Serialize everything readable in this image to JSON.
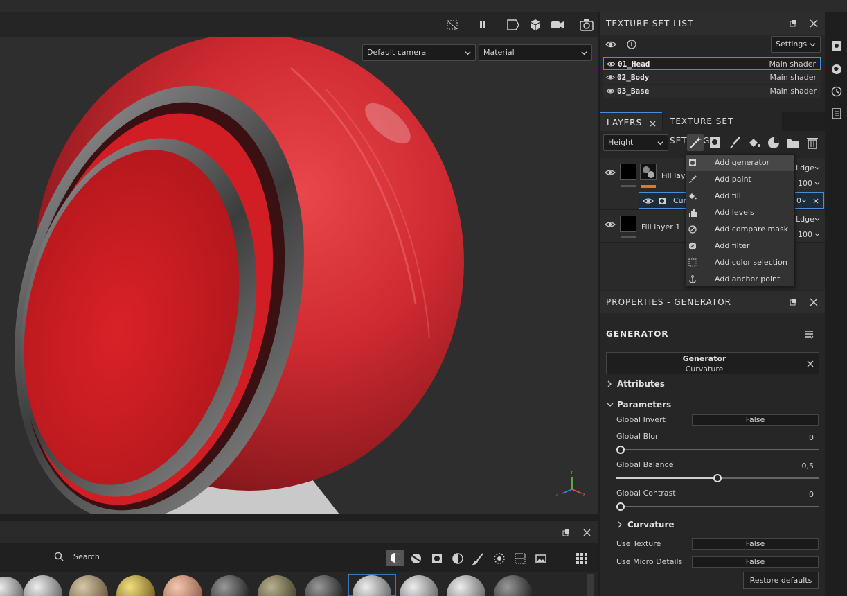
{
  "viewport": {
    "camera_select": "Default camera",
    "mode_select": "Material"
  },
  "texture_set_list": {
    "title": "TEXTURE SET LIST",
    "settings_label": "Settings",
    "items": [
      {
        "name": "01_Head",
        "shader": "Main shader"
      },
      {
        "name": "02_Body",
        "shader": "Main shader"
      },
      {
        "name": "03_Base",
        "shader": "Main shader"
      }
    ]
  },
  "layers_panel": {
    "tab_layers": "LAYERS",
    "tab_texture_settings": "TEXTURE SET SETTINGS",
    "channel_select": "Height",
    "layers": [
      {
        "name": "Fill lay",
        "blend": "Ldge",
        "opacity": "100"
      },
      {
        "name": "Cur",
        "opacity": "0"
      },
      {
        "name": "Fill layer 1",
        "blend": "Ldge",
        "opacity": "100"
      }
    ]
  },
  "add_menu": {
    "items": [
      {
        "label": "Add generator",
        "icon": "generator-icon"
      },
      {
        "label": "Add paint",
        "icon": "brush-icon"
      },
      {
        "label": "Add fill",
        "icon": "fill-bucket-icon"
      },
      {
        "label": "Add levels",
        "icon": "levels-icon"
      },
      {
        "label": "Add compare mask",
        "icon": "compare-mask-icon"
      },
      {
        "label": "Add filter",
        "icon": "filter-icon"
      },
      {
        "label": "Add color selection",
        "icon": "color-selection-icon"
      },
      {
        "label": "Add anchor point",
        "icon": "anchor-icon"
      }
    ]
  },
  "properties": {
    "title": "PROPERTIES - GENERATOR",
    "section_title": "GENERATOR",
    "generator_name": "Generator",
    "generator_type": "Curvature",
    "attributes_label": "Attributes",
    "parameters_label": "Parameters",
    "global_invert_label": "Global Invert",
    "global_invert_value": "False",
    "global_blur_label": "Global Blur",
    "global_blur_value": "0",
    "global_blur_fraction": 0,
    "global_balance_label": "Global Balance",
    "global_balance_value": "0,5",
    "global_balance_fraction": 0.5,
    "global_contrast_label": "Global Contrast",
    "global_contrast_value": "0",
    "global_contrast_fraction": 0,
    "curvature_label": "Curvature",
    "use_texture_label": "Use Texture",
    "use_texture_value": "False",
    "use_micro_label": "Use Micro Details",
    "use_micro_value": "False",
    "restore_label": "Restore defaults"
  },
  "shelf": {
    "search_label": "Search"
  },
  "colors": {
    "accent_blue": "#4a90d9",
    "accent_orange": "#e8761c",
    "material_red": "#d6252b"
  }
}
